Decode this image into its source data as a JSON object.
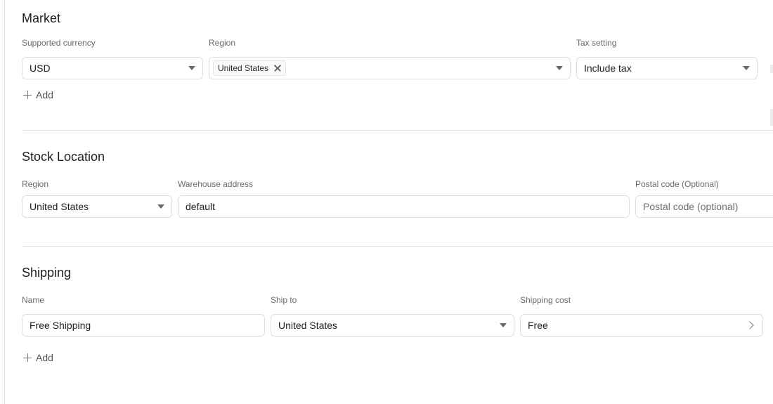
{
  "market": {
    "title": "Market",
    "currency_label": "Supported currency",
    "currency_value": "USD",
    "region_label": "Region",
    "region_tag": "United States",
    "tax_label": "Tax setting",
    "tax_value": "Include tax",
    "add_label": "Add"
  },
  "stock_location": {
    "title": "Stock Location",
    "region_label": "Region",
    "region_value": "United States",
    "warehouse_label": "Warehouse address",
    "warehouse_value": "default",
    "postal_label": "Postal code (Optional)",
    "postal_placeholder": "Postal code (optional)"
  },
  "shipping": {
    "title": "Shipping",
    "name_label": "Name",
    "name_value": "Free Shipping",
    "ship_to_label": "Ship to",
    "ship_to_value": "United States",
    "cost_label": "Shipping cost",
    "cost_value": "Free",
    "add_label": "Add"
  },
  "icons": {
    "dropdown": "caret-down-icon",
    "remove_tag": "close-icon",
    "add": "plus-icon",
    "open": "chevron-right-icon"
  }
}
